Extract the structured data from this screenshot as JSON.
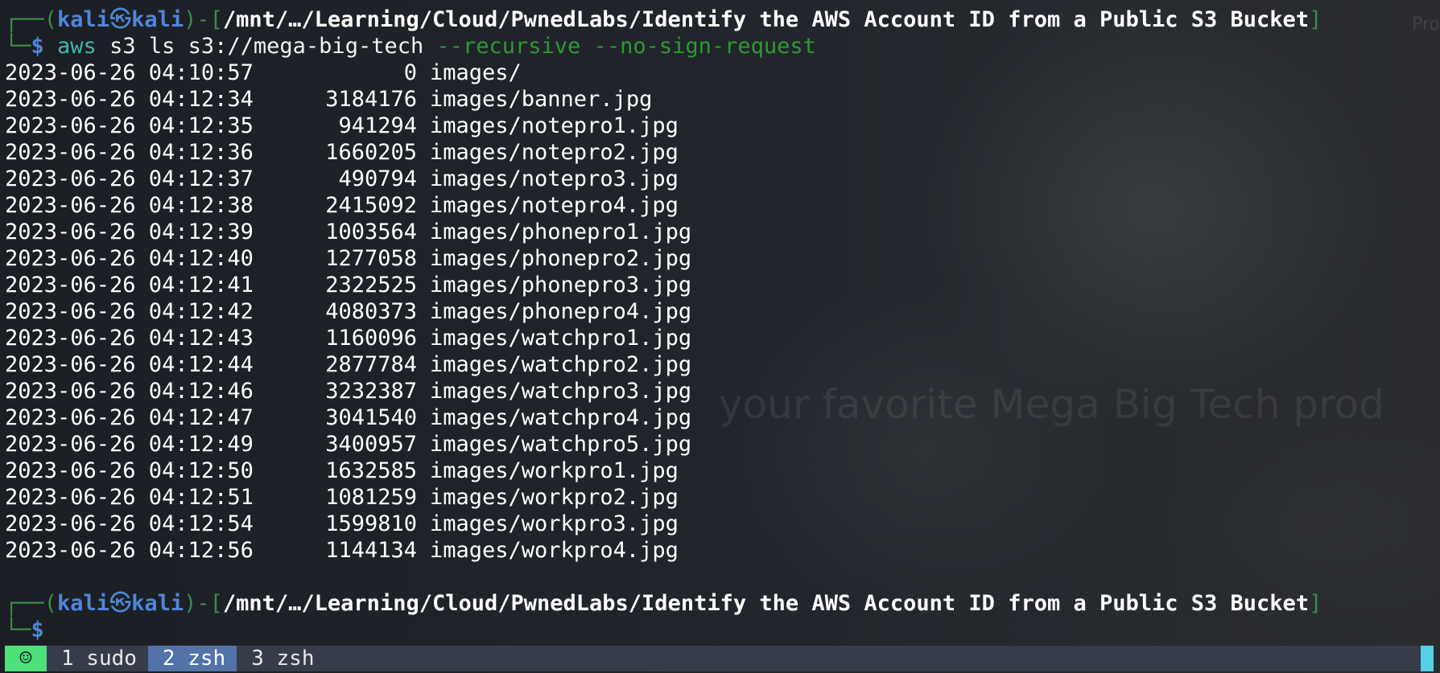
{
  "prompt": {
    "user": "kali",
    "separator_glyph": "㉿",
    "host": "kali",
    "path": "/mnt/…/Learning/Cloud/PwnedLabs/Identify the AWS Account ID from a Public S3 Bucket",
    "symbol": "$"
  },
  "command": {
    "name": "aws",
    "args": "s3 ls s3://mega-big-tech",
    "flags": "--recursive --no-sign-request"
  },
  "listing": [
    {
      "date": "2023-06-26 04:10:57",
      "size": "0",
      "key": "images/"
    },
    {
      "date": "2023-06-26 04:12:34",
      "size": "3184176",
      "key": "images/banner.jpg"
    },
    {
      "date": "2023-06-26 04:12:35",
      "size": "941294",
      "key": "images/notepro1.jpg"
    },
    {
      "date": "2023-06-26 04:12:36",
      "size": "1660205",
      "key": "images/notepro2.jpg"
    },
    {
      "date": "2023-06-26 04:12:37",
      "size": "490794",
      "key": "images/notepro3.jpg"
    },
    {
      "date": "2023-06-26 04:12:38",
      "size": "2415092",
      "key": "images/notepro4.jpg"
    },
    {
      "date": "2023-06-26 04:12:39",
      "size": "1003564",
      "key": "images/phonepro1.jpg"
    },
    {
      "date": "2023-06-26 04:12:40",
      "size": "1277058",
      "key": "images/phonepro2.jpg"
    },
    {
      "date": "2023-06-26 04:12:41",
      "size": "2322525",
      "key": "images/phonepro3.jpg"
    },
    {
      "date": "2023-06-26 04:12:42",
      "size": "4080373",
      "key": "images/phonepro4.jpg"
    },
    {
      "date": "2023-06-26 04:12:43",
      "size": "1160096",
      "key": "images/watchpro1.jpg"
    },
    {
      "date": "2023-06-26 04:12:44",
      "size": "2877784",
      "key": "images/watchpro2.jpg"
    },
    {
      "date": "2023-06-26 04:12:46",
      "size": "3232387",
      "key": "images/watchpro3.jpg"
    },
    {
      "date": "2023-06-26 04:12:47",
      "size": "3041540",
      "key": "images/watchpro4.jpg"
    },
    {
      "date": "2023-06-26 04:12:49",
      "size": "3400957",
      "key": "images/watchpro5.jpg"
    },
    {
      "date": "2023-06-26 04:12:50",
      "size": "1632585",
      "key": "images/workpro1.jpg"
    },
    {
      "date": "2023-06-26 04:12:51",
      "size": "1081259",
      "key": "images/workpro2.jpg"
    },
    {
      "date": "2023-06-26 04:12:54",
      "size": "1599810",
      "key": "images/workpro3.jpg"
    },
    {
      "date": "2023-06-26 04:12:56",
      "size": "1144134",
      "key": "images/workpro4.jpg"
    }
  ],
  "background": {
    "tagline": "your favorite Mega Big Tech prod",
    "corner_text": "Pro"
  },
  "tabbar": {
    "status_icon": "smiley-icon",
    "status_glyph": "☺",
    "tabs": [
      {
        "label": "1 sudo",
        "active": false
      },
      {
        "label": "2 zsh",
        "active": true
      },
      {
        "label": "3 zsh",
        "active": false
      }
    ]
  },
  "colors": {
    "prompt_frame": "#3a8d4a",
    "prompt_user": "#4f86d8",
    "command_name": "#3fb8a8",
    "command_flags": "#2e9a32",
    "status_segment": "#4ee07a",
    "active_tab": "#5273a8",
    "tabbar_bg": "#363c4a"
  }
}
